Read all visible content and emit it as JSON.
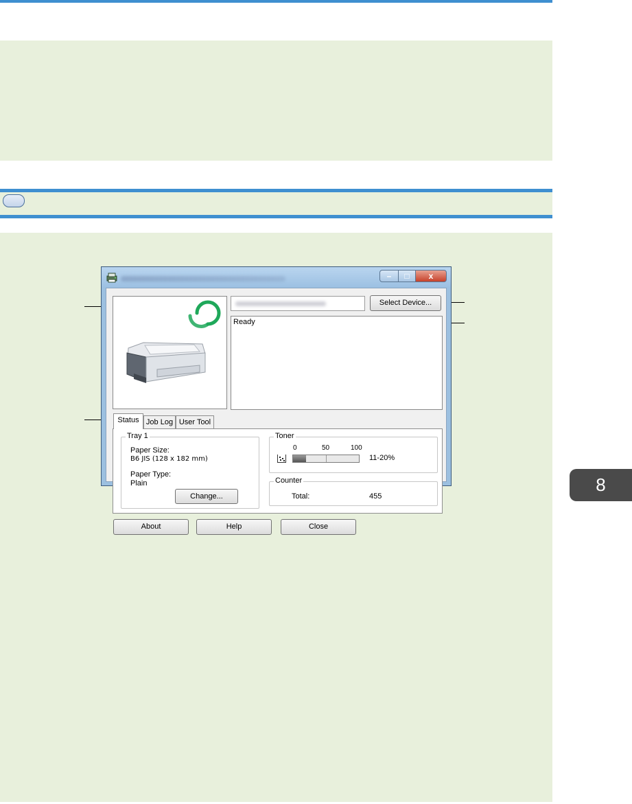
{
  "chapter": {
    "number": "8"
  },
  "window": {
    "title": "",
    "controls": {
      "minimize": "–",
      "maximize": "□",
      "close": "x"
    },
    "device_name": "",
    "select_device_label": "Select Device...",
    "status_message": "Ready",
    "tabs": [
      {
        "label": "Status",
        "active": true
      },
      {
        "label": "Job Log",
        "active": false
      },
      {
        "label": "User Tool",
        "active": false
      }
    ],
    "tray": {
      "group_title": "Tray 1",
      "paper_size_label": "Paper Size:",
      "paper_size_value": "B6 JIS (128 x 182 mm)",
      "paper_type_label": "Paper Type:",
      "paper_type_value": "Plain",
      "change_label": "Change..."
    },
    "toner": {
      "group_title": "Toner",
      "scale": [
        "0",
        "50",
        "100"
      ],
      "level_text": "11-20%",
      "level_fraction": 0.2
    },
    "counter": {
      "group_title": "Counter",
      "total_label": "Total:",
      "total_value": "455"
    },
    "buttons": {
      "about": "About",
      "help": "Help",
      "close": "Close"
    }
  },
  "colors": {
    "accent_blue": "#3f8fd0",
    "panel_green": "#e8f0dc",
    "status_ring": "#1fa85a",
    "chapter_tab": "#4a4a4a"
  }
}
